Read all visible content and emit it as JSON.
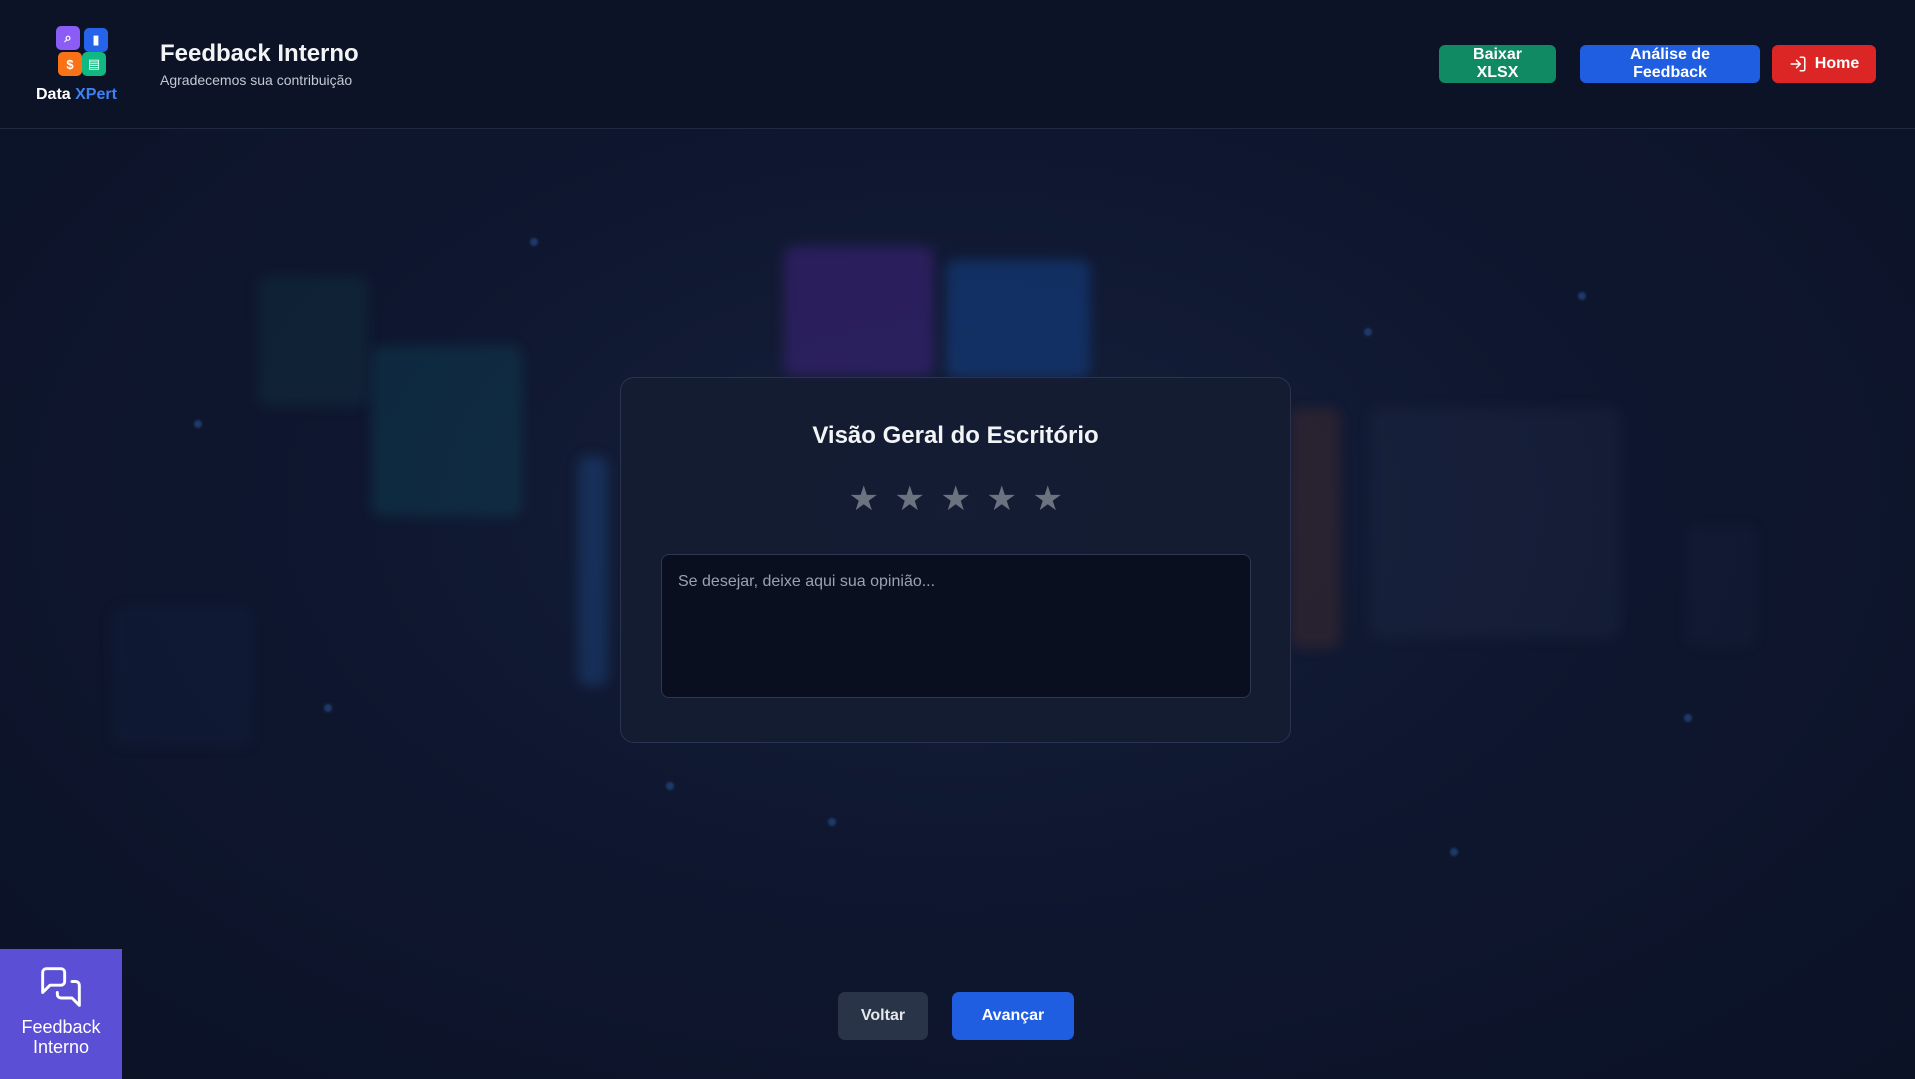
{
  "brand": {
    "name_prefix": "Data ",
    "name_suffix": "XPert",
    "logo_icon": "data-xpert-logo"
  },
  "header": {
    "title": "Feedback Interno",
    "subtitle": "Agradecemos sua contribuição",
    "buttons": {
      "xlsx": "Baixar XLSX",
      "analise": "Análise de Feedback",
      "home": "Home"
    },
    "colors": {
      "xlsx": "#0f8a63",
      "analise": "#1f5ee0",
      "home": "#dc2626"
    }
  },
  "card": {
    "title": "Visão Geral do Escritório",
    "rating": {
      "max": 5,
      "value": 0,
      "star_glyph": "★"
    },
    "comment": {
      "value": "",
      "placeholder": "Se desejar, deixe aqui sua opinião..."
    }
  },
  "footer": {
    "back": "Voltar",
    "next": "Avançar"
  },
  "side_tab": {
    "line1": "Feedback",
    "line2": "Interno",
    "icon": "chat-bubbles-icon"
  }
}
